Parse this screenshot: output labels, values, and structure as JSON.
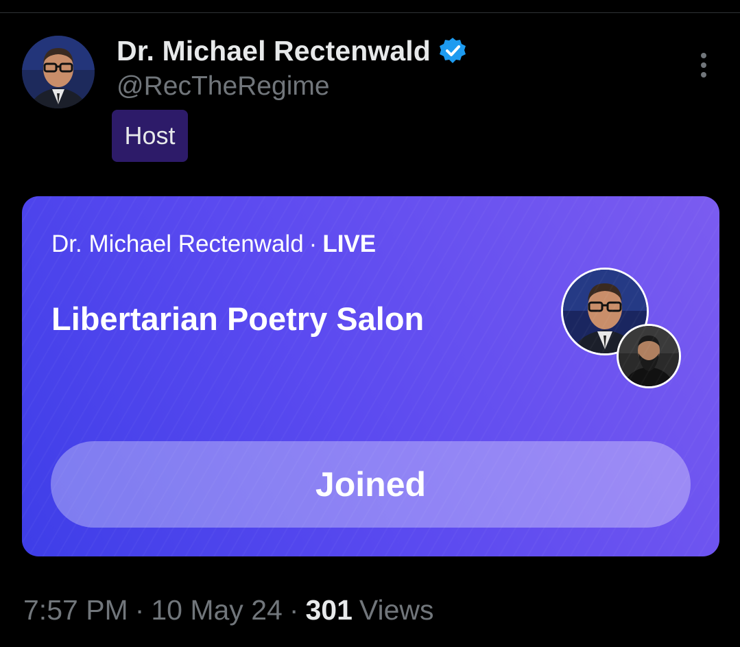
{
  "author": {
    "display_name": "Dr. Michael Rectenwald",
    "handle": "@RecTheRegime",
    "role_badge": "Host",
    "verified_icon": "verified-badge-icon",
    "avatar_icon": "author-avatar"
  },
  "space": {
    "host_name": "Dr. Michael Rectenwald",
    "separator": "·",
    "status": "LIVE",
    "title": "Libertarian Poetry Salon",
    "button_label": "Joined",
    "participant_avatars": [
      "host-avatar",
      "speaker-avatar"
    ]
  },
  "meta": {
    "time": "7:57 PM",
    "date": "10 May 24",
    "separator": "·",
    "views_count": "301",
    "views_label": "Views"
  },
  "colors": {
    "background": "#000000",
    "verified_blue": "#1d9bf0",
    "host_badge": "#2d1b69",
    "space_card_start": "#3e3ee8",
    "space_card_end": "#7b5cf0"
  }
}
